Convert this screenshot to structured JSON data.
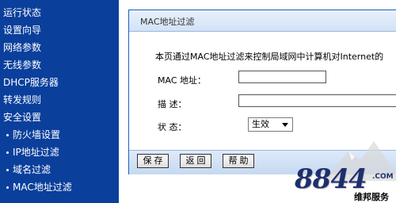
{
  "sidebar": {
    "items": [
      {
        "label": "运行状态",
        "sub": false
      },
      {
        "label": "设置向导",
        "sub": false
      },
      {
        "label": "网络参数",
        "sub": false
      },
      {
        "label": "无线参数",
        "sub": false
      },
      {
        "label": "DHCP服务器",
        "sub": false
      },
      {
        "label": "转发规则",
        "sub": false
      },
      {
        "label": "安全设置",
        "sub": false
      },
      {
        "label": "防火墙设置",
        "sub": true
      },
      {
        "label": "IP地址过滤",
        "sub": true
      },
      {
        "label": "域名过滤",
        "sub": true
      },
      {
        "label": "MAC地址过滤",
        "sub": true
      }
    ]
  },
  "panel": {
    "title": "MAC地址过滤",
    "description": "本页通过MAC地址过滤来控制局域网中计算机对Internet的",
    "fields": {
      "mac_label": "MAC 地址：",
      "mac_value": "",
      "desc_label": "描 述：",
      "desc_value": "",
      "status_label": "状 态：",
      "status_value": "生效"
    },
    "buttons": {
      "save": "保存",
      "back": "返回",
      "help": "帮助"
    }
  },
  "watermark": {
    "logo": "8844",
    "domain": ".COM",
    "subtitle": "维邦服务"
  },
  "colors": {
    "sidebar_bg": "#0a3f9c",
    "panel_border": "#1c5fc0"
  }
}
